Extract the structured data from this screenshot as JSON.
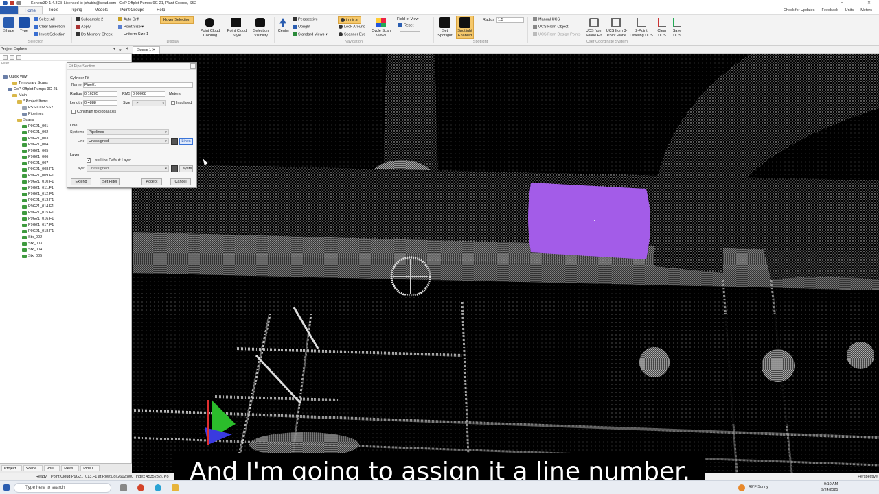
{
  "app": {
    "title": "Kohera3D 1.4.3.28 Licensed to jshubin@sead.com - CoP Offplot Pumps 9G-21, Plant Coords, SS2"
  },
  "menu": {
    "tabs": [
      "Home",
      "Tools",
      "Piping",
      "Models",
      "Point Groups",
      "Help"
    ],
    "right": [
      "Check for Updates",
      "Feedback",
      "Units",
      "Meters"
    ]
  },
  "ribbon": {
    "selection": {
      "shape": "Shape",
      "type": "Type",
      "select_all": "Select All",
      "clear_selection": "Clear Selection",
      "invert_selection": "Invert Selection",
      "label": "Selection"
    },
    "display": {
      "subsample": "Subsample",
      "subsample_value": "2",
      "apply": "Apply",
      "memory_check": "Do Memory Check",
      "auto_drift": "Auto Drift",
      "point_size": "Point Size",
      "uniform_size": "Uniform Size",
      "uniform_value": "1",
      "hover_selection": "Hover Selection",
      "point_cloud_coloring": "Point Cloud Coloring",
      "point_cloud_style": "Point Cloud Style",
      "selection_visibility": "Selection Visibility",
      "label": "Display"
    },
    "navigation": {
      "center": "Center",
      "perspective": "Perspective",
      "upright": "Upright",
      "standard_views": "Standard Views",
      "look_at": "Look at",
      "look_around": "Look Around",
      "scanner_eye": "Scanner Eye",
      "cycle_scan_views": "Cycle Scan Views",
      "field_of_view": "Field of View",
      "reset": "Reset",
      "label": "Navigation"
    },
    "spotlight": {
      "set_spotlight": "Set Spotlight",
      "spotlight_enabled": "Spotlight Enabled",
      "radius": "Radius",
      "radius_value": "1.5",
      "label": "Spotlight"
    },
    "ucs": {
      "manual_ucs": "Manual UCS",
      "ucs_from_object": "UCS From Object",
      "ucs_from_design": "UCS From Design Points",
      "ucs_from_plane_fit": "UCS from Plane Fit",
      "ucs_from_3_point": "UCS from 3-Point Plane",
      "two_point_leveling": "2-Point Leveling UCS",
      "clear_ucs": "Clear UCS",
      "save_ucs": "Save UCS",
      "label": "User Coordinate System"
    }
  },
  "explorer": {
    "title": "Project Explorer",
    "filter_placeholder": "Filter",
    "tree": [
      {
        "label": "Quick View",
        "indent": 0,
        "color": "#6b7fa8"
      },
      {
        "label": "Temporary Scans",
        "indent": 2,
        "color": "#d9b84a"
      },
      {
        "label": "CoP Offplot Pumps 9G-21,",
        "indent": 1,
        "color": "#6b7fa8"
      },
      {
        "label": "Main",
        "indent": 2,
        "color": "#d9b84a"
      },
      {
        "label": "* Project Items",
        "indent": 3,
        "color": "#d9b84a"
      },
      {
        "label": "PSS COP SS2",
        "indent": 4,
        "color": "#9aa3b0"
      },
      {
        "label": "Pipelines",
        "indent": 4,
        "color": "#7a8aa8"
      },
      {
        "label": "Scans",
        "indent": 3,
        "color": "#d9b84a"
      },
      {
        "label": "P9G21_001",
        "indent": 4,
        "color": "#3f9a3f"
      },
      {
        "label": "P9G21_002",
        "indent": 4,
        "color": "#3f9a3f"
      },
      {
        "label": "P9G21_003",
        "indent": 4,
        "color": "#3f9a3f"
      },
      {
        "label": "P9G21_004",
        "indent": 4,
        "color": "#3f9a3f"
      },
      {
        "label": "P9G21_005",
        "indent": 4,
        "color": "#3f9a3f"
      },
      {
        "label": "P9G21_006",
        "indent": 4,
        "color": "#3f9a3f"
      },
      {
        "label": "P9G21_007",
        "indent": 4,
        "color": "#3f9a3f"
      },
      {
        "label": "P9G21_008.F1",
        "indent": 4,
        "color": "#3f9a3f"
      },
      {
        "label": "P9G21_009.F1",
        "indent": 4,
        "color": "#3f9a3f"
      },
      {
        "label": "P9G21_010.F1",
        "indent": 4,
        "color": "#3f9a3f"
      },
      {
        "label": "P9G21_011.F1",
        "indent": 4,
        "color": "#3f9a3f"
      },
      {
        "label": "P9G21_012.F1",
        "indent": 4,
        "color": "#3f9a3f"
      },
      {
        "label": "P9G21_013.F1",
        "indent": 4,
        "color": "#3f9a3f"
      },
      {
        "label": "P9G21_014.F1",
        "indent": 4,
        "color": "#3f9a3f"
      },
      {
        "label": "P9G21_015.F1",
        "indent": 4,
        "color": "#3f9a3f"
      },
      {
        "label": "P9G21_016.F1",
        "indent": 4,
        "color": "#3f9a3f"
      },
      {
        "label": "P9G21_017.F1",
        "indent": 4,
        "color": "#3f9a3f"
      },
      {
        "label": "P9G21_018.F1",
        "indent": 4,
        "color": "#3f9a3f"
      },
      {
        "label": "Stx_002",
        "indent": 4,
        "color": "#3f9a3f"
      },
      {
        "label": "Stx_003",
        "indent": 4,
        "color": "#3f9a3f"
      },
      {
        "label": "Stx_004",
        "indent": 4,
        "color": "#3f9a3f"
      },
      {
        "label": "Stx_005",
        "indent": 4,
        "color": "#3f9a3f"
      }
    ],
    "bottom_tabs": [
      "Project...",
      "Scene...",
      "Volu...",
      "Meas...",
      "Pipe L..."
    ]
  },
  "scene": {
    "tab_label": "Scene 1",
    "highlight_color": "#a35ce8"
  },
  "dialog": {
    "title": "Fit Pipe Section",
    "cylinder_fit": "Cylinder Fit",
    "name_label": "Name",
    "name_value": "Pipe01",
    "radius_label": "Radius",
    "radius_value": "0.16205",
    "rms_label": "RMS",
    "rms_value": "0.00068",
    "rms_unit": "Meters",
    "length_label": "Length",
    "length_value": "0.4888",
    "size_label": "Size",
    "size_value": "12\"",
    "insulated": "Insulated",
    "constrain": "Constrain to global axis",
    "line_section": "Line",
    "systems_label": "Systems",
    "systems_value": "Pipelines",
    "line_label": "Line",
    "line_value": "Unassigned",
    "lines_button": "Lines",
    "layer_section": "Layer",
    "use_default_layer": "Use Line Default Layer",
    "layer_label": "Layer",
    "layer_value": "Unassigned",
    "layers_button": "Layers",
    "extend": "Extend",
    "set_filter": "Set Filter",
    "accept": "Accept",
    "cancel": "Cancel"
  },
  "status": {
    "ready": "Ready",
    "message": "Point Cloud P9G21_013.F1 at Row:Col 2612:800 (Index 4535232), Po",
    "right": "Perspective"
  },
  "caption": "And I'm going to assign it a line number.",
  "taskbar": {
    "search_placeholder": "Type here to search",
    "weather": "49°F  Sunny",
    "time": "9:10 AM",
    "date": "9/24/2025"
  }
}
